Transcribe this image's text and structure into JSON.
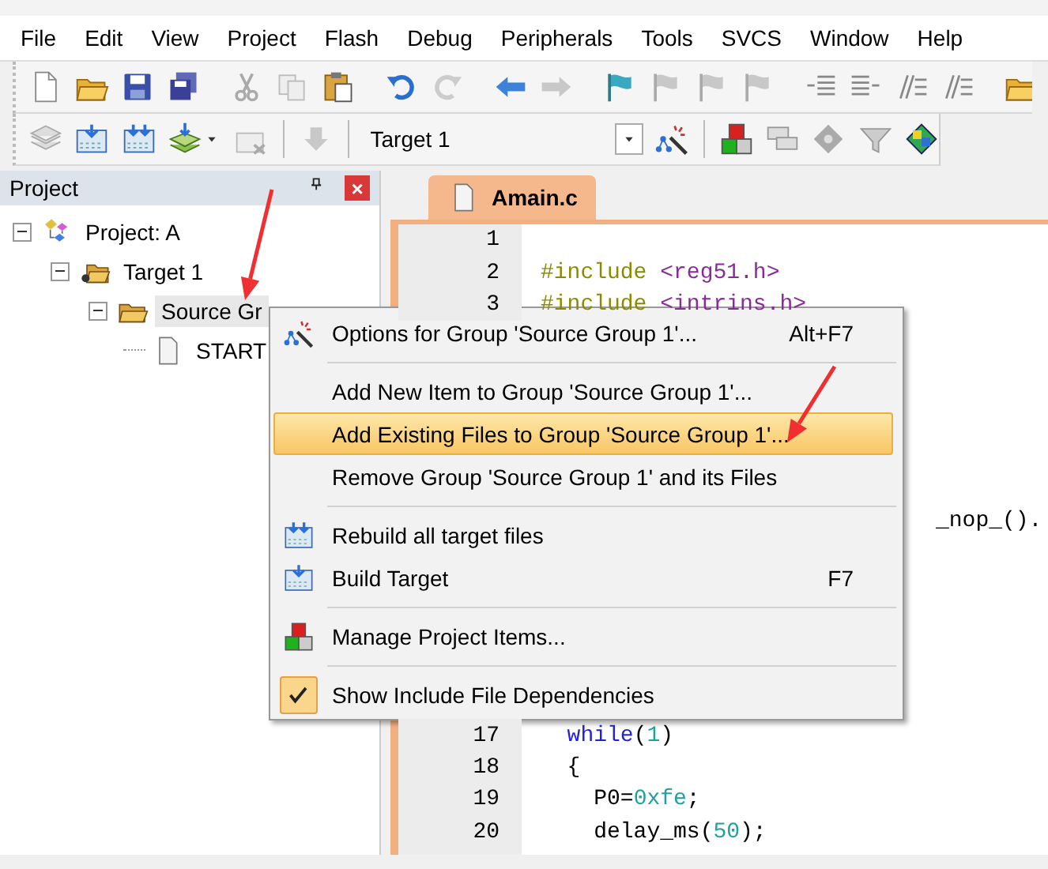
{
  "menu_bar": [
    "File",
    "Edit",
    "View",
    "Project",
    "Flash",
    "Debug",
    "Peripherals",
    "Tools",
    "SVCS",
    "Window",
    "Help"
  ],
  "build_toolbar": {
    "target_select": {
      "value": "Target 1"
    }
  },
  "project_panel": {
    "title": "Project",
    "close_label": "×",
    "tree": [
      {
        "label": "Project: A",
        "kind": "project",
        "expanded": true,
        "selected": false,
        "children": [
          {
            "label": "Target 1",
            "kind": "target",
            "expanded": true,
            "selected": false,
            "children": [
              {
                "label": "Source Gr",
                "kind": "group",
                "expanded": true,
                "selected": true,
                "children": [
                  {
                    "label": "START",
                    "kind": "file",
                    "selected": false
                  }
                ]
              }
            ]
          }
        ]
      }
    ]
  },
  "editor": {
    "tab": {
      "label": "Amain.c",
      "selected": true
    },
    "top_lines": [
      {
        "number": "1"
      },
      {
        "number": "2",
        "tokens": [
          {
            "text": "#include ",
            "kind": "directive"
          },
          {
            "text": "<reg51.h>",
            "kind": "header"
          }
        ]
      },
      {
        "number": "3",
        "tokens": [
          {
            "text": "#include ",
            "kind": "directive"
          },
          {
            "text": "<intrins.h>",
            "kind": "header"
          }
        ]
      }
    ],
    "side_fragment": "_nop_().",
    "bottom_lines": [
      {
        "number": "17",
        "tokens": [
          {
            "text": "  while",
            "kind": "keyword"
          },
          {
            "text": "(",
            "kind": "plain"
          },
          {
            "text": "1",
            "kind": "number"
          },
          {
            "text": ")",
            "kind": "plain"
          }
        ]
      },
      {
        "number": "18",
        "tokens": [
          {
            "text": "  {",
            "kind": "plain"
          }
        ]
      },
      {
        "number": "19",
        "tokens": [
          {
            "text": "    P0=",
            "kind": "plain"
          },
          {
            "text": "0xfe",
            "kind": "number"
          },
          {
            "text": ";",
            "kind": "plain"
          }
        ]
      },
      {
        "number": "20",
        "tokens": [
          {
            "text": "    delay_ms(",
            "kind": "plain"
          },
          {
            "text": "50",
            "kind": "number"
          },
          {
            "text": ");",
            "kind": "plain"
          }
        ]
      }
    ]
  },
  "context_menu": {
    "items": [
      {
        "kind": "options",
        "label": "Options for Group 'Source Group 1'...",
        "shortcut": "Alt+F7",
        "selected": false
      },
      {
        "kind": "separator"
      },
      {
        "kind": "command",
        "label": "Add New  Item to Group 'Source Group 1'...",
        "selected": false
      },
      {
        "kind": "command",
        "label": "Add Existing Files to Group 'Source Group 1'...",
        "selected": true
      },
      {
        "kind": "command",
        "label": "Remove Group 'Source Group 1' and its Files",
        "selected": false
      },
      {
        "kind": "separator"
      },
      {
        "kind": "rebuild",
        "label": "Rebuild all target files",
        "selected": false
      },
      {
        "kind": "build",
        "label": "Build Target",
        "shortcut": "F7",
        "selected": false
      },
      {
        "kind": "separator"
      },
      {
        "kind": "manage",
        "label": "Manage Project Items...",
        "selected": false
      },
      {
        "kind": "separator"
      },
      {
        "kind": "toggle",
        "label": "Show Include File Dependencies",
        "selected": false,
        "checked": true
      }
    ]
  }
}
